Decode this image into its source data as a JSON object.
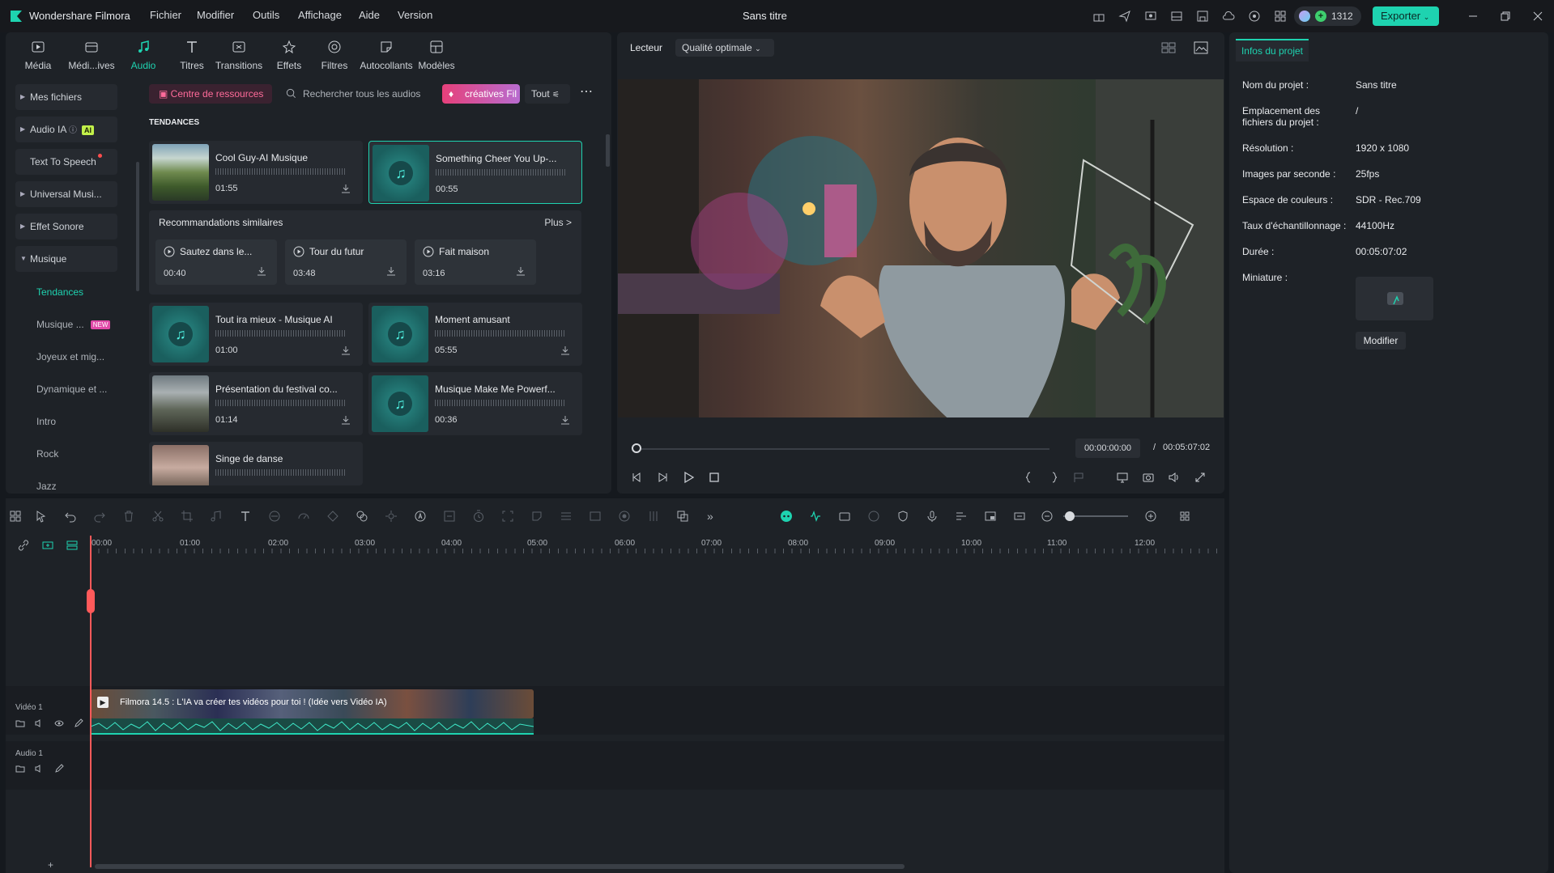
{
  "app": {
    "name": "Wondershare Filmora",
    "doc_title": "Sans titre"
  },
  "menu": [
    "Fichier",
    "Modifier",
    "Outils",
    "Affichage",
    "Aide",
    "Version"
  ],
  "titlebar": {
    "credits": "1312",
    "export_label": "Exporter"
  },
  "tabs": [
    {
      "label": "Média",
      "icon": "media-icon"
    },
    {
      "label": "Médi...ives",
      "icon": "stock-media-icon"
    },
    {
      "label": "Audio",
      "icon": "music-note-icon",
      "active": true
    },
    {
      "label": "Titres",
      "icon": "title-icon"
    },
    {
      "label": "Transitions",
      "icon": "transitions-icon"
    },
    {
      "label": "Effets",
      "icon": "effects-icon"
    },
    {
      "label": "Filtres",
      "icon": "filters-icon"
    },
    {
      "label": "Autocollants",
      "icon": "stickers-icon"
    },
    {
      "label": "Modèles",
      "icon": "templates-icon"
    }
  ],
  "sidebar": {
    "items": [
      "Mes fichiers",
      "Audio IA",
      "Text To Speech",
      "Universal Musi...",
      "Effet Sonore",
      "Musique"
    ],
    "ai_badge": "AI",
    "sub_items": [
      "Tendances",
      "Musique ...",
      "Joyeux et mig...",
      "Dynamique et ...",
      "Intro",
      "Rock",
      "Jazz"
    ],
    "new_badge": "NEW"
  },
  "toolbar": {
    "resource_center": "Centre de ressources",
    "search_placeholder": "Rechercher tous les audios",
    "creative": "créatives Fil",
    "filter": "Tout"
  },
  "section_title": "TENDANCES",
  "cards": [
    {
      "title": "Cool Guy-AI Musique",
      "duration": "01:55"
    },
    {
      "title": "Something Cheer You Up-...",
      "duration": "00:55"
    },
    {
      "title": "Tout ira mieux - Musique AI",
      "duration": "01:00"
    },
    {
      "title": "Moment amusant",
      "duration": "05:55"
    },
    {
      "title": "Présentation du festival co...",
      "duration": "01:14"
    },
    {
      "title": "Musique Make Me Powerf...",
      "duration": "00:36"
    },
    {
      "title": "Singe de danse",
      "duration": ""
    }
  ],
  "recommendations": {
    "title": "Recommandations similaires",
    "more": "Plus >",
    "items": [
      {
        "title": "Sautez dans le...",
        "duration": "00:40"
      },
      {
        "title": "Tour du futur",
        "duration": "03:48"
      },
      {
        "title": "Fait maison",
        "duration": "03:16"
      }
    ]
  },
  "player": {
    "label": "Lecteur",
    "quality": "Qualité optimale",
    "current": "00:00:00:00",
    "separator": "/",
    "total": "00:05:07:02"
  },
  "info": {
    "tab": "Infos du projet",
    "fields": [
      {
        "label": "Nom du projet :",
        "value": "Sans titre"
      },
      {
        "label": "Emplacement des fichiers du projet :",
        "value": "/"
      },
      {
        "label": "Résolution :",
        "value": "1920 x 1080"
      },
      {
        "label": "Images par seconde :",
        "value": "25fps"
      },
      {
        "label": "Espace de couleurs :",
        "value": "SDR - Rec.709"
      },
      {
        "label": "Taux d'échantillonnage :",
        "value": "44100Hz"
      },
      {
        "label": "Durée :",
        "value": "00:05:07:02"
      },
      {
        "label": "Miniature :",
        "value": ""
      }
    ],
    "modify": "Modifier"
  },
  "timeline": {
    "ruler": [
      "00:00",
      "01:00",
      "02:00",
      "03:00",
      "04:00",
      "05:00",
      "06:00",
      "07:00",
      "08:00",
      "09:00",
      "10:00",
      "11:00",
      "12:00"
    ],
    "video_track": "Vidéo 1",
    "audio_track": "Audio 1",
    "clip_title": "Filmora 14.5 : L'IA va créer tes vidéos pour toi ! (Idée vers Vidéo IA)"
  },
  "colors": {
    "accent": "#1ed3b0",
    "playhead": "#ff5a5a",
    "brand_pink": "#e6407a"
  }
}
